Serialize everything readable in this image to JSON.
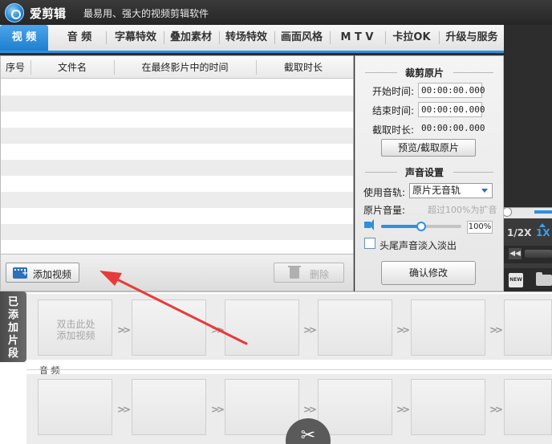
{
  "window": {
    "app_name": "爱剪辑",
    "slogan": "最易用、强大的视频剪辑软件"
  },
  "tabs": [
    {
      "label": "视 频",
      "active": true
    },
    {
      "label": "音 频"
    },
    {
      "label": "字幕特效"
    },
    {
      "label": "叠加素材"
    },
    {
      "label": "转场特效"
    },
    {
      "label": "画面风格"
    },
    {
      "label": "M T V"
    },
    {
      "label": "卡拉OK"
    },
    {
      "label": "升级与服务"
    }
  ],
  "table": {
    "columns": [
      "序号",
      "文件名",
      "在最终影片中的时间",
      "截取时长"
    ],
    "rows": []
  },
  "buttons": {
    "add_video": "添加视频",
    "delete": "删除",
    "preview_clip": "预览/截取原片",
    "confirm": "确认修改"
  },
  "edit_panel": {
    "clip_section_title": "裁剪原片",
    "start_label": "开始时间:",
    "start_value": "00:00:00.000",
    "end_label": "结束时间:",
    "end_value": "00:00:00.000",
    "duration_label": "截取时长:",
    "duration_value": "00:00:00.000",
    "sound_section_title": "声音设置",
    "track_label": "使用音轨:",
    "track_selected": "原片无音轨",
    "volume_label": "原片音量:",
    "volume_hint": "超过100%为扩音",
    "volume_value": "100%",
    "volume_level_percent": 100,
    "fade_label": "头尾声音淡入淡出",
    "fade_checked": false
  },
  "preview": {
    "speed_half": "1/2X",
    "speed_one": "1X"
  },
  "timeline": {
    "added_tab_label": "已添加片段",
    "empty_clip_hint_line1": "双击此处",
    "empty_clip_hint_line2": "添加视频",
    "audio_track_label": "音 频"
  },
  "colors": {
    "accent": "#2f8fde",
    "title_bar": "#2b2b2b",
    "annotation_arrow": "#e83a3a"
  }
}
